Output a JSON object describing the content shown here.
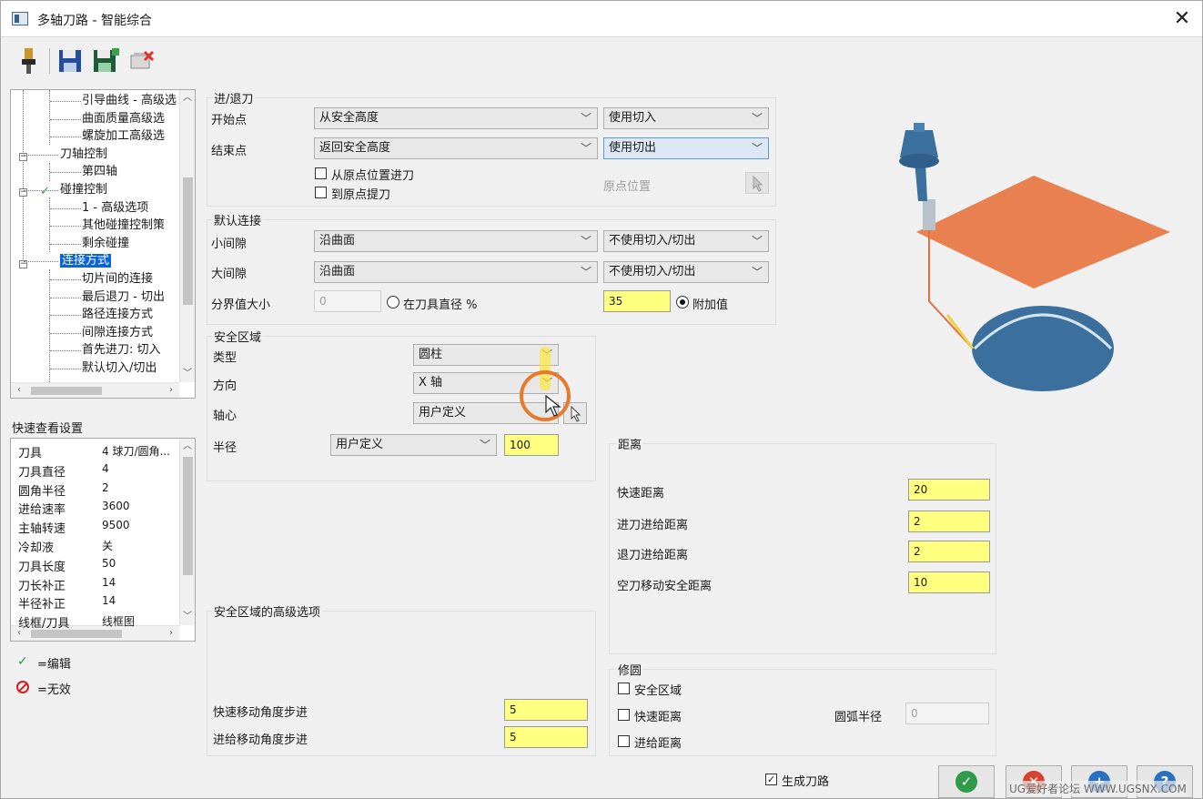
{
  "window": {
    "title": "多轴刀路 - 智能综合",
    "close_glyph": "✕"
  },
  "toolbar": {
    "buttons": [
      {
        "name": "tool-icon"
      },
      {
        "name": "save-icon"
      },
      {
        "name": "save-as-icon"
      },
      {
        "name": "remove-icon"
      }
    ]
  },
  "tree": {
    "items": [
      {
        "label": "引导曲线 - 高级选",
        "level": 2
      },
      {
        "label": "曲面质量高级选",
        "level": 2
      },
      {
        "label": "螺旋加工高级选",
        "level": 2
      },
      {
        "label": "刀轴控制",
        "level": 1
      },
      {
        "label": "第四轴",
        "level": 2
      },
      {
        "label": "碰撞控制",
        "level": 1
      },
      {
        "label": "1 - 高级选项",
        "level": 2
      },
      {
        "label": "其他碰撞控制策",
        "level": 2
      },
      {
        "label": "剩余碰撞",
        "level": 2
      },
      {
        "label": "连接方式",
        "level": 1
      },
      {
        "label": "切片间的连接",
        "level": 2
      },
      {
        "label": "最后退刀 - 切出",
        "level": 2
      },
      {
        "label": "路径连接方式",
        "level": 2
      },
      {
        "label": "间隙连接方式",
        "level": 2
      },
      {
        "label": "首先进刀: 切入",
        "level": 2
      },
      {
        "label": "默认切入/切出",
        "level": 2
      }
    ],
    "check_glyph": "✓"
  },
  "quick_view": {
    "title": "快速查看设置",
    "rows": [
      {
        "key": "刀具",
        "value": "4 球刀/圆角..."
      },
      {
        "key": "刀具直径",
        "value": "4"
      },
      {
        "key": "圆角半径",
        "value": "2"
      },
      {
        "key": "进给速率",
        "value": "3600"
      },
      {
        "key": "主轴转速",
        "value": "9500"
      },
      {
        "key": "冷却液",
        "value": "关"
      },
      {
        "key": "刀具长度",
        "value": "50"
      },
      {
        "key": "刀长补正",
        "value": "14"
      },
      {
        "key": "半径补正",
        "value": "14"
      },
      {
        "key": "线框/刀具",
        "value": "线框图"
      }
    ]
  },
  "legend": {
    "edit": "=编辑",
    "invalid": "=无效"
  },
  "entry_exit": {
    "title": "进/退刀",
    "start_label": "开始点",
    "start_value": "从安全高度",
    "start_mode": "使用切入",
    "end_label": "结束点",
    "end_value": "返回安全高度",
    "end_mode": "使用切出",
    "from_origin": "从原点位置进刀",
    "to_origin": "到原点提刀",
    "origin_pos": "原点位置"
  },
  "default_link": {
    "title": "默认连接",
    "small_gap_label": "小间隙",
    "small_gap_value": "沿曲面",
    "small_gap_mode": "不使用切入/切出",
    "large_gap_label": "大间隙",
    "large_gap_value": "沿曲面",
    "large_gap_mode": "不使用切入/切出",
    "threshold_label": "分界值大小",
    "threshold_value": "0",
    "pct_label": "在刀具直径 %",
    "add_value": "35",
    "add_label": "附加值"
  },
  "safe_zone": {
    "title": "安全区域",
    "type_label": "类型",
    "type_value": "圆柱",
    "dir_label": "方向",
    "dir_value": "X 轴",
    "axis_label": "轴心",
    "axis_value": "用户定义",
    "radius_label": "半径",
    "radius_mode": "用户定义",
    "radius_value": "100"
  },
  "distance": {
    "title": "距离",
    "rows": [
      {
        "label": "快速距离",
        "value": "20"
      },
      {
        "label": "进刀进给距离",
        "value": "2"
      },
      {
        "label": "退刀进给距离",
        "value": "2"
      },
      {
        "label": "空刀移动安全距离",
        "value": "10"
      }
    ]
  },
  "safe_adv": {
    "title": "安全区域的高级选项",
    "rapid_label": "快速移动角度步进",
    "rapid_value": "5",
    "feed_label": "进给移动角度步进",
    "feed_value": "5"
  },
  "fillet": {
    "title": "修圆",
    "safe_zone": "安全区域",
    "rapid": "快速距离",
    "feed": "进给距离",
    "arc_label": "圆弧半径",
    "arc_value": "0"
  },
  "footer": {
    "generate": "生成刀路",
    "check": "✓",
    "watermark": "UG爱好者论坛 WWW.UGSNX.COM"
  },
  "colors": {
    "accent": "#0a64d6",
    "input_yellow": "#ffff80",
    "plane": "#e88050",
    "body": "#3a6f9e"
  }
}
